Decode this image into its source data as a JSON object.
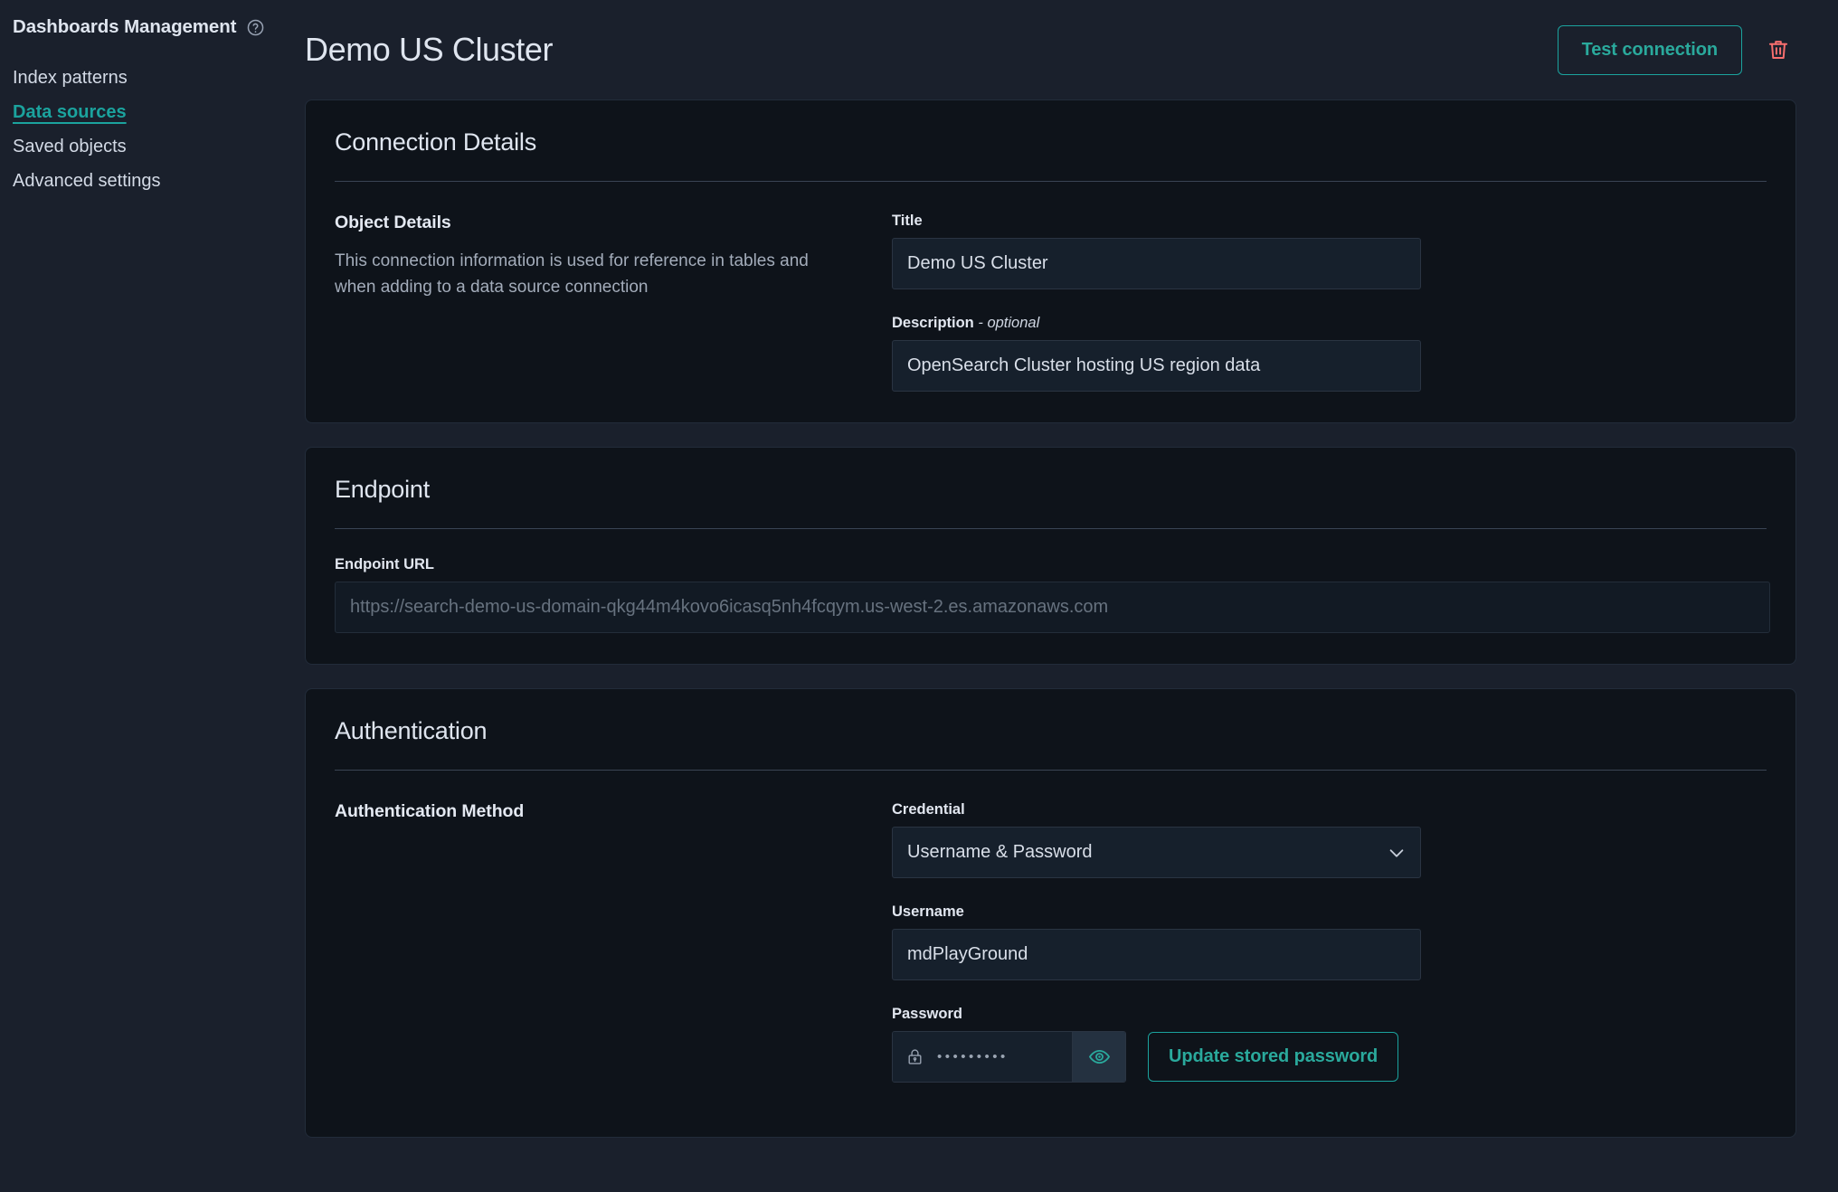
{
  "sidebar": {
    "title": "Dashboards Management",
    "help_icon": "help-circle-icon",
    "items": [
      {
        "label": "Index patterns",
        "active": false
      },
      {
        "label": "Data sources",
        "active": true
      },
      {
        "label": "Saved objects",
        "active": false
      },
      {
        "label": "Advanced settings",
        "active": false
      }
    ]
  },
  "header": {
    "title": "Demo US Cluster",
    "test_connection_label": "Test connection",
    "delete_icon": "trash-icon"
  },
  "panels": {
    "connection_details": {
      "title": "Connection Details",
      "section_heading": "Object Details",
      "section_description": "This connection information is used for reference in tables and when adding to a data source connection",
      "title_field": {
        "label": "Title",
        "value": "Demo US Cluster"
      },
      "description_field": {
        "label": "Description",
        "label_optional": " - optional",
        "value": "OpenSearch Cluster hosting US region data"
      }
    },
    "endpoint": {
      "title": "Endpoint",
      "url_field": {
        "label": "Endpoint URL",
        "value": "https://search-demo-us-domain-qkg44m4kovo6icasq5nh4fcqym.us-west-2.es.amazonaws.com"
      }
    },
    "authentication": {
      "title": "Authentication",
      "section_heading": "Authentication Method",
      "credential_field": {
        "label": "Credential",
        "value": "Username & Password",
        "chevron_icon": "chevron-down-icon"
      },
      "username_field": {
        "label": "Username",
        "value": "mdPlayGround"
      },
      "password_field": {
        "label": "Password",
        "masked_value": "•••••••••",
        "lock_icon": "lock-icon",
        "reveal_icon": "eye-icon"
      },
      "update_password_label": "Update stored password"
    }
  },
  "colors": {
    "accent": "#1ba39e",
    "accent_text": "#2aa99c",
    "danger": "#f76e6e",
    "page_bg": "#1a202c",
    "panel_bg": "#0e131a"
  }
}
